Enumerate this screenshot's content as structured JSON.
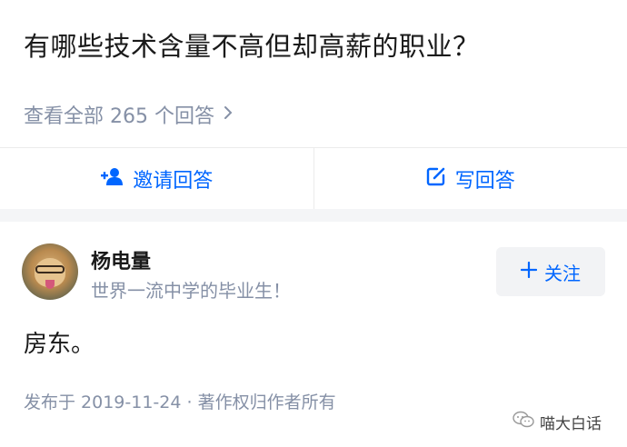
{
  "question": {
    "title": "有哪些技术含量不高但却高薪的职业？",
    "view_all": "查看全部 265 个回答"
  },
  "actions": {
    "invite_label": "邀请回答",
    "write_label": "写回答"
  },
  "answer": {
    "author_name": "杨电量",
    "author_bio": "世界一流中学的毕业生！",
    "follow_label": "关注",
    "content": "房东。",
    "meta": "发布于 2019-11-24 · 著作权归作者所有"
  },
  "watermark": {
    "text": "喵大白话"
  },
  "icons": {
    "chevron": "chevron-right-icon",
    "invite": "add-user-icon",
    "write": "edit-icon",
    "follow": "plus-icon",
    "watermark": "wechat-icon"
  },
  "colors": {
    "accent": "#0066ff",
    "muted": "#8590a6",
    "text": "#1a1a1a",
    "band": "#f4f5f7"
  }
}
